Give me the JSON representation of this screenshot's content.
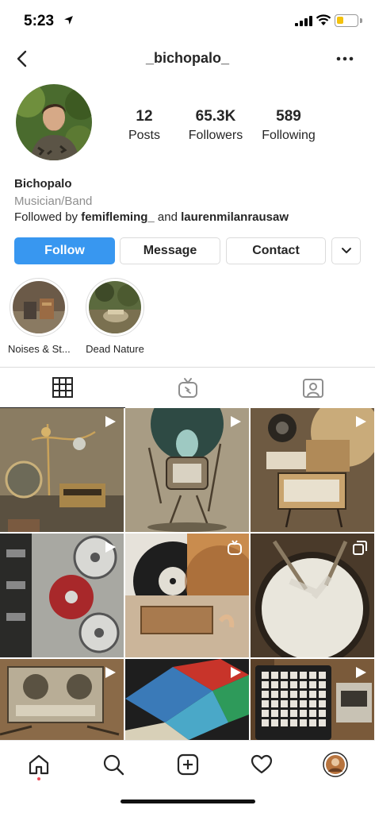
{
  "status": {
    "time": "5:23"
  },
  "header": {
    "username": "_bichopalo_"
  },
  "stats": {
    "posts": {
      "value": "12",
      "label": "Posts"
    },
    "followers": {
      "value": "65.3K",
      "label": "Followers"
    },
    "following": {
      "value": "589",
      "label": "Following"
    }
  },
  "bio": {
    "name": "Bichopalo",
    "category": "Musician/Band",
    "followed_prefix": "Followed by ",
    "followed_user1": "femifleming_",
    "followed_and": " and ",
    "followed_user2": "laurenmilanrausaw"
  },
  "buttons": {
    "follow": "Follow",
    "message": "Message",
    "contact": "Contact"
  },
  "highlights": [
    {
      "label": "Noises & St..."
    },
    {
      "label": "Dead Nature"
    }
  ],
  "tabs": [
    {
      "icon": "grid-icon"
    },
    {
      "icon": "igtv-icon"
    },
    {
      "icon": "tagged-icon"
    }
  ],
  "posts": [
    {
      "type": "video"
    },
    {
      "type": "video"
    },
    {
      "type": "video"
    },
    {
      "type": "video"
    },
    {
      "type": "igtv"
    },
    {
      "type": "carousel"
    },
    {
      "type": "video"
    },
    {
      "type": "video"
    },
    {
      "type": "video"
    }
  ],
  "nav": [
    {
      "icon": "home-icon"
    },
    {
      "icon": "search-icon"
    },
    {
      "icon": "add-post-icon"
    },
    {
      "icon": "heart-icon"
    },
    {
      "icon": "profile-avatar-icon"
    }
  ],
  "colors": {
    "accent": "#3897f0",
    "text": "#262626",
    "muted": "#8e8e8e",
    "border": "#dbdbdb",
    "notification": "#ed4956"
  },
  "battery_level": 0.35
}
